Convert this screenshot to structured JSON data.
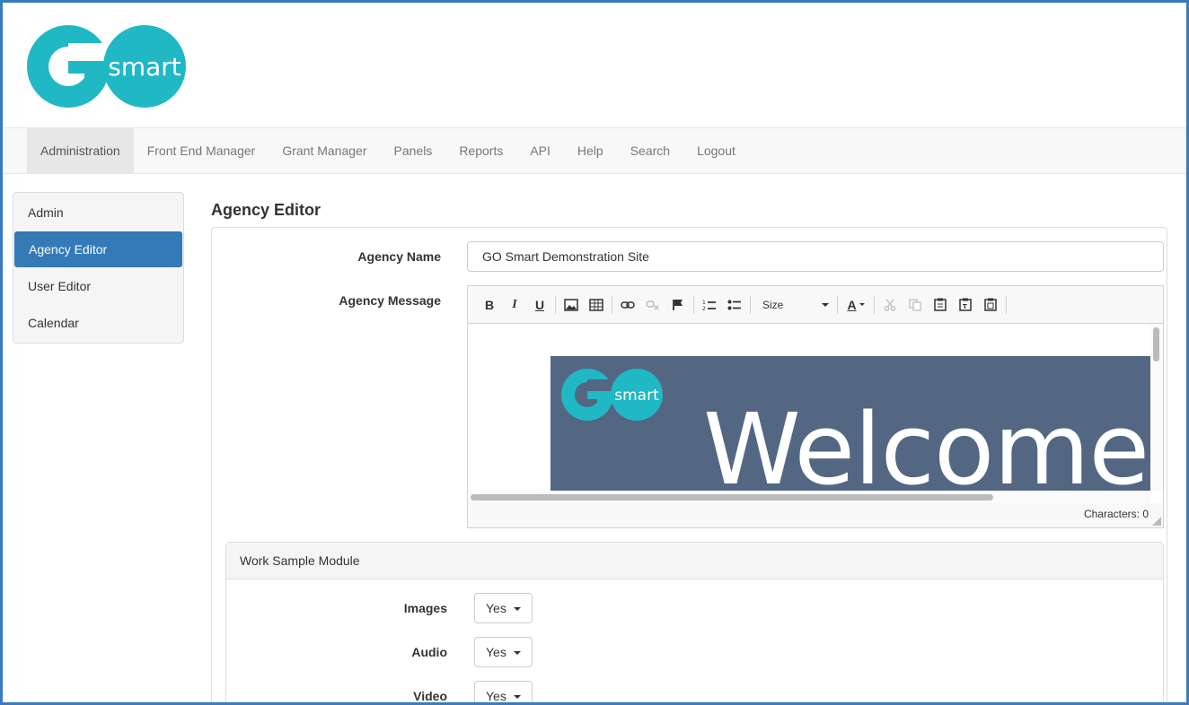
{
  "brand": {
    "logo_text_go": "GO",
    "logo_text_smart": "smart",
    "color": "#20b8c4"
  },
  "nav": {
    "items": [
      {
        "label": "Administration",
        "active": true
      },
      {
        "label": "Front End Manager"
      },
      {
        "label": "Grant Manager"
      },
      {
        "label": "Panels"
      },
      {
        "label": "Reports"
      },
      {
        "label": "API"
      },
      {
        "label": "Help"
      },
      {
        "label": "Search"
      },
      {
        "label": "Logout"
      }
    ]
  },
  "sidebar": {
    "items": [
      {
        "label": "Admin"
      },
      {
        "label": "Agency Editor",
        "active": true
      },
      {
        "label": "User Editor"
      },
      {
        "label": "Calendar"
      }
    ]
  },
  "page": {
    "title": "Agency Editor"
  },
  "form": {
    "agency_name_label": "Agency Name",
    "agency_name_value": "GO Smart Demonstration Site",
    "agency_message_label": "Agency Message"
  },
  "editor": {
    "size_label": "Size",
    "characters_label": "Characters: 0",
    "banner_text": "Welcome",
    "banner_color": "#536783"
  },
  "work_sample": {
    "title": "Work Sample Module",
    "rows": [
      {
        "label": "Images",
        "value": "Yes"
      },
      {
        "label": "Audio",
        "value": "Yes"
      },
      {
        "label": "Video",
        "value": "Yes"
      }
    ]
  }
}
